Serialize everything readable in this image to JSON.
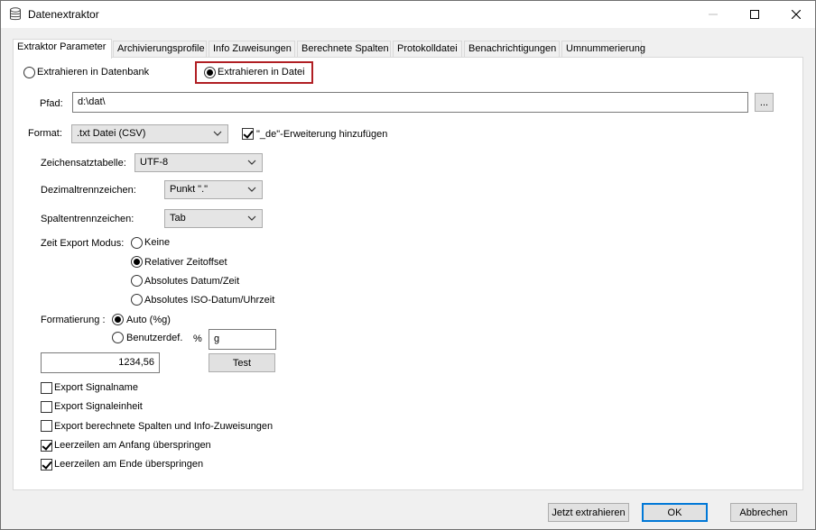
{
  "window": {
    "title": "Datenextraktor"
  },
  "tabs": [
    {
      "label": "Extraktor Parameter"
    },
    {
      "label": "Archivierungsprofile"
    },
    {
      "label": "Info Zuweisungen"
    },
    {
      "label": "Berechnete Spalten"
    },
    {
      "label": "Protokolldatei"
    },
    {
      "label": "Benachrichtigungen"
    },
    {
      "label": "Umnummerierung"
    }
  ],
  "target": {
    "db_label": "Extrahieren in Datenbank",
    "file_label": "Extrahieren in Datei",
    "selected": "file"
  },
  "path": {
    "label": "Pfad:",
    "value": "d:\\dat\\",
    "browse_label": "..."
  },
  "format": {
    "label": "Format:",
    "value": ".txt Datei (CSV)",
    "ext_label": "\"_de\"-Erweiterung hinzufügen",
    "ext_checked": true
  },
  "charset": {
    "label": "Zeichensatztabelle:",
    "value": "UTF-8"
  },
  "decimal": {
    "label": "Dezimaltrennzeichen:",
    "value": "Punkt \".\""
  },
  "column_sep": {
    "label": "Spaltentrennzeichen:",
    "value": "Tab"
  },
  "time_mode": {
    "label": "Zeit Export Modus:",
    "options": [
      "Keine",
      "Relativer Zeitoffset",
      "Absolutes Datum/Zeit",
      "Absolutes ISO-Datum/Uhrzeit"
    ],
    "selected_index": 1
  },
  "formatting": {
    "label": "Formatierung :",
    "auto_label": "Auto (%g)",
    "custom_label": "Benutzerdef.",
    "percent": "%",
    "custom_value": "g",
    "preview_value": "1234,56",
    "test_label": "Test",
    "selected": "auto"
  },
  "options": [
    {
      "label": "Export Signalname",
      "checked": false
    },
    {
      "label": "Export Signaleinheit",
      "checked": false
    },
    {
      "label": "Export berechnete Spalten und Info-Zuweisungen",
      "checked": false
    },
    {
      "label": "Leerzeilen am Anfang überspringen",
      "checked": true
    },
    {
      "label": "Leerzeilen am Ende überspringen",
      "checked": true
    }
  ],
  "footer": {
    "extract_label": "Jetzt extrahieren",
    "ok_label": "OK",
    "cancel_label": "Abbrechen"
  },
  "colors": {
    "highlight": "#b01e23",
    "default_button": "#0078d7"
  }
}
